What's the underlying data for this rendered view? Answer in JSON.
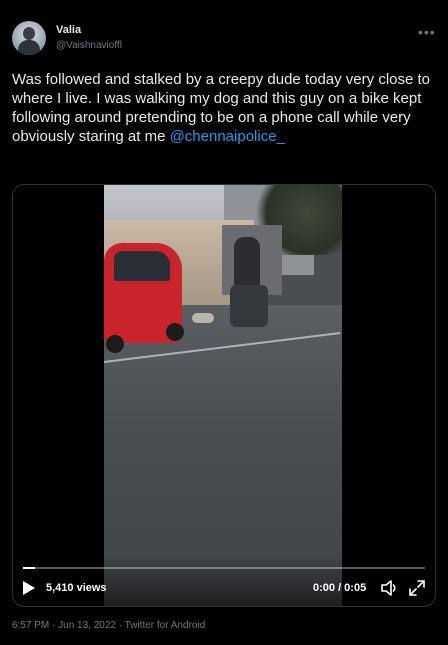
{
  "user": {
    "display_name": "Valia",
    "handle": "@Vaishnavioffl"
  },
  "tweet": {
    "text": "Was followed and stalked by a creepy dude today very close to where I live. I was walking my dog and this guy on a bike kept following around pretending to be on a phone call while very obviously staring at me",
    "mention": "@chennaipolice_",
    "timestamp": "6:57 PM · Jun 13, 2022 · Twitter for Android"
  },
  "video": {
    "views": "5,410 views",
    "time": "0:00 / 0:05",
    "progress": 0.03
  },
  "icons": {
    "more": "more-dots-icon",
    "play": "play-icon",
    "volume": "volume-icon",
    "fullscreen": "fullscreen-icon"
  },
  "colors": {
    "background": "#000000",
    "text": "#e7e9ea",
    "secondary": "#71767b",
    "link": "#1d9bf0",
    "car": "#c9242c"
  }
}
